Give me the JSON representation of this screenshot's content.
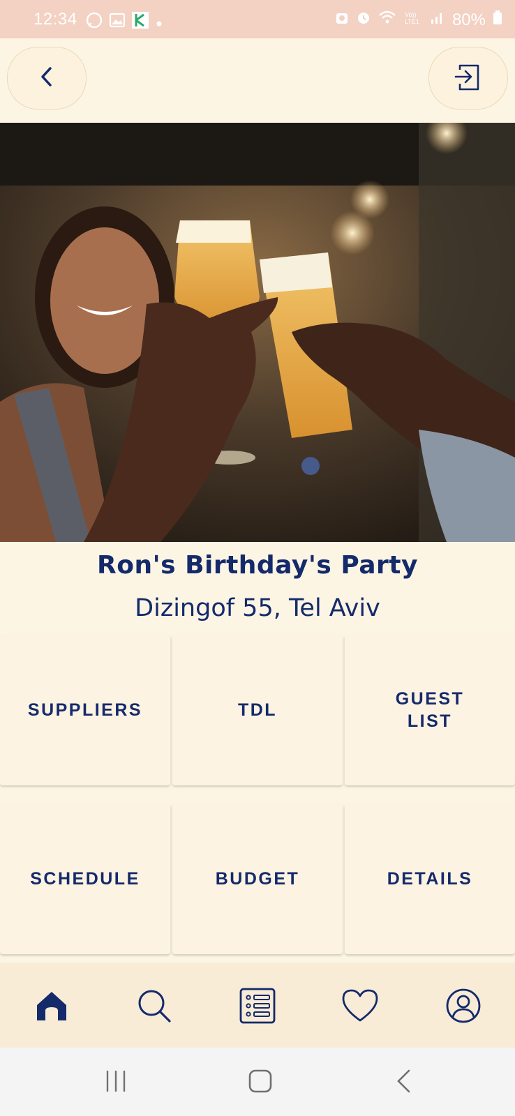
{
  "status_bar": {
    "time": "12:34",
    "battery": "80%",
    "left_icons": [
      "whatsapp-icon",
      "gallery-icon",
      "app-icon",
      "dot-icon"
    ],
    "right_icons": [
      "sync-icon",
      "alarm-icon",
      "wifi-icon",
      "volte-icon",
      "signal-icon",
      "battery-icon"
    ]
  },
  "header": {
    "back_icon": "chevron-left-icon",
    "exit_icon": "exit-icon"
  },
  "event": {
    "title": "Ron's Birthday's Party",
    "address": "Dizingof 55, Tel Aviv"
  },
  "tiles": [
    {
      "label": "SUPPLIERS"
    },
    {
      "label": "TDL"
    },
    {
      "label": "GUEST\nLIST"
    },
    {
      "label": "SCHEDULE"
    },
    {
      "label": "BUDGET"
    },
    {
      "label": "DETAILS"
    }
  ],
  "bottom_nav": [
    {
      "icon": "home-icon",
      "active": true
    },
    {
      "icon": "search-icon",
      "active": false
    },
    {
      "icon": "list-icon",
      "active": false
    },
    {
      "icon": "heart-icon",
      "active": false
    },
    {
      "icon": "profile-icon",
      "active": false
    }
  ],
  "colors": {
    "primary": "#142a6b",
    "background": "#fdf5e4",
    "status_bar": "#f3d1c3",
    "nav_bar": "#f8ecd6"
  }
}
